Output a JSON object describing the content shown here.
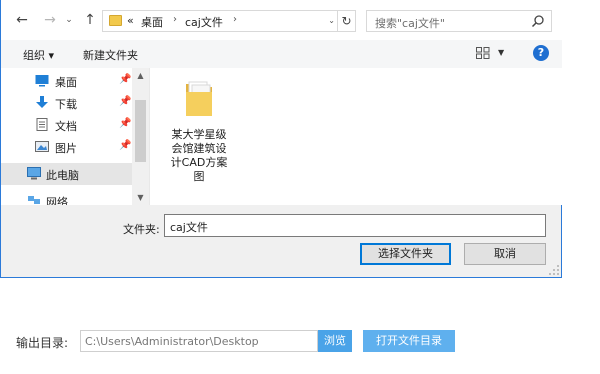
{
  "address": {
    "crumb_prefix": "«",
    "crumbs": [
      "桌面",
      "caj文件"
    ],
    "refresh_icon": "refresh-icon"
  },
  "search": {
    "placeholder": "搜索\"caj文件\""
  },
  "toolbar": {
    "organize_label": "组织 ▾",
    "new_folder_label": "新建文件夹"
  },
  "navpane": {
    "items": [
      {
        "label": "桌面",
        "icon": "desktop-icon",
        "pinned": true
      },
      {
        "label": "下载",
        "icon": "download-icon",
        "pinned": true
      },
      {
        "label": "文档",
        "icon": "document-icon",
        "pinned": true
      },
      {
        "label": "图片",
        "icon": "picture-icon",
        "pinned": true
      },
      {
        "label": "此电脑",
        "icon": "computer-icon",
        "pinned": false,
        "selected": true
      },
      {
        "label": "网络",
        "icon": "network-icon",
        "pinned": false
      }
    ]
  },
  "files": [
    {
      "name": "某大学星级会馆建筑设计CAD方案图",
      "icon": "folder-icon"
    }
  ],
  "dialog": {
    "folder_label": "文件夹:",
    "folder_value": "caj文件",
    "select_button": "选择文件夹",
    "cancel_button": "取消"
  },
  "app": {
    "output_label": "输出目录:",
    "output_path": "C:\\Users\\Administrator\\Desktop",
    "browse_button": "浏览",
    "open_button": "打开文件目录"
  },
  "colors": {
    "accent": "#0078d7",
    "app_button": "#4aa3e8",
    "folder_yellow": "#f2c94c"
  }
}
